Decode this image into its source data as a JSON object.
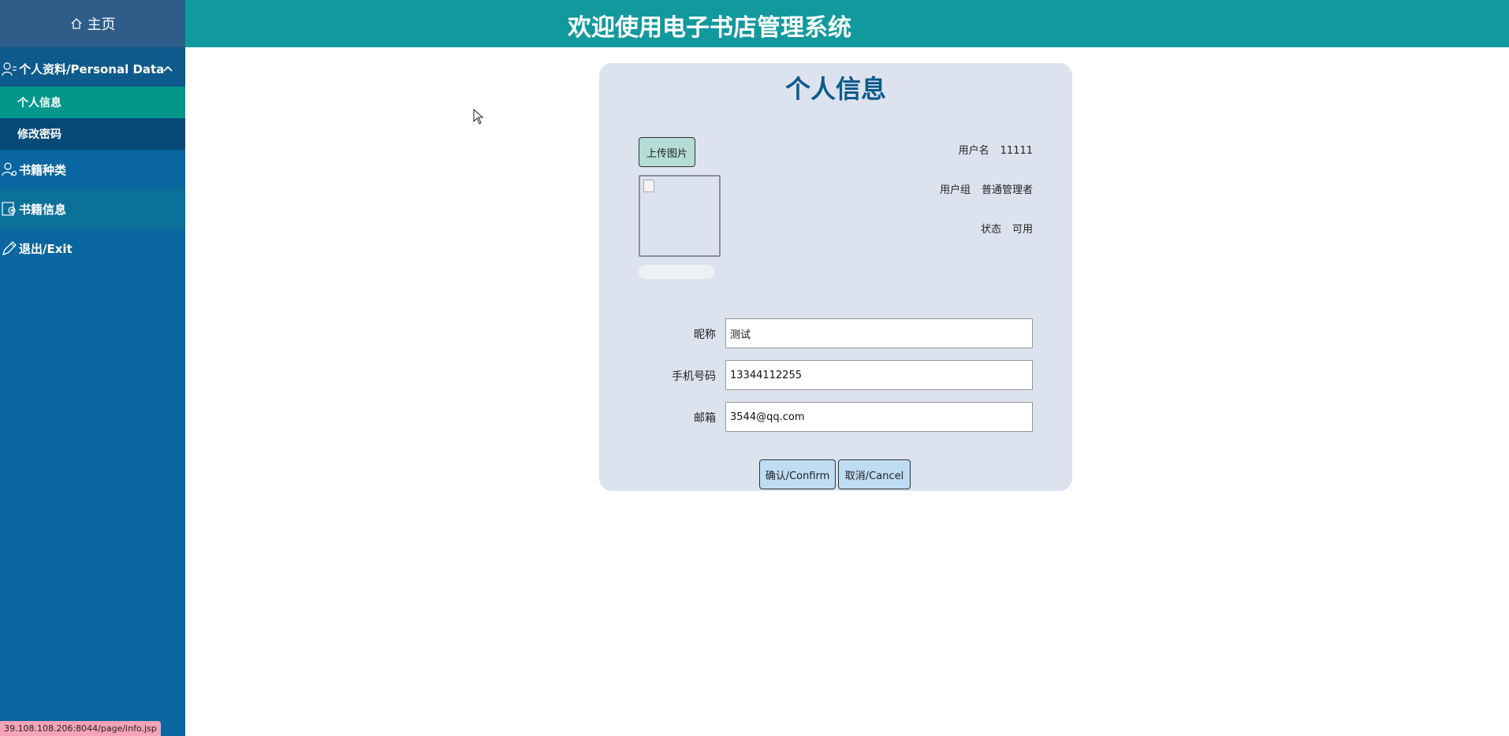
{
  "sidebar": {
    "home_label": "主页",
    "personal_label": "个人资料/Personal Data",
    "sub_items": [
      {
        "label": "个人信息"
      },
      {
        "label": "修改密码"
      }
    ],
    "category_label": "书籍种类",
    "books_label": "书籍信息",
    "exit_label": "退出/Exit"
  },
  "header": {
    "title": "欢迎使用电子书店管理系统"
  },
  "card": {
    "title": "个人信息",
    "upload_label": "上传图片",
    "info": {
      "username_label": "用户名",
      "username_value": "11111",
      "group_label": "用户组",
      "group_value": "普通管理者",
      "status_label": "状态",
      "status_value": "可用"
    },
    "form": {
      "nickname_label": "昵称",
      "nickname_value": "测试",
      "phone_label": "手机号码",
      "phone_value": "13344112255",
      "email_label": "邮箱",
      "email_value": "3544@qq.com"
    },
    "confirm_label": "确认/Confirm",
    "cancel_label": "取消/Cancel"
  },
  "status_bar": {
    "url": "39.108.108.206:8044/page/info.jsp"
  },
  "colors": {
    "header": "#12999e",
    "sidebar": "#0a66a0",
    "active_item": "#03978b",
    "card_bg": "#dce3ee",
    "title_blue": "#0e5a8c"
  }
}
